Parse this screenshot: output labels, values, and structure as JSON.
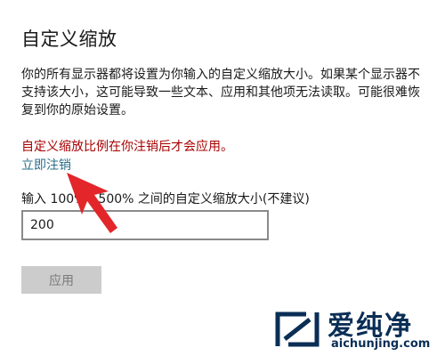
{
  "page": {
    "title": "自定义缩放",
    "description_lines": [
      "你的所有显示器都将设置为你输入的自定义缩放大小。如果某个显示器不",
      "支持该大小，这可能导致一些文本、应用和其他项无法读取。可能很难恢",
      "复到你的原始设置。"
    ],
    "warning": "自定义缩放比例在你注销后才会应用。",
    "signout_link": "立即注销",
    "input_label": "输入 100% - 500% 之间的自定义缩放大小(不建议)",
    "input_value": "200",
    "apply_label": "应用"
  },
  "watermark": {
    "brand": "爱纯净",
    "url": "aichunjing.com"
  },
  "colors": {
    "warning": "#a80000",
    "link": "#2b6d8a",
    "arrow": "#e3262a",
    "button_disabled_bg": "#cccccc",
    "watermark": "#0a2e55"
  },
  "icons": {
    "annotation": "red-arrow-icon",
    "watermark_logo": "aichunjing-logo-icon"
  }
}
